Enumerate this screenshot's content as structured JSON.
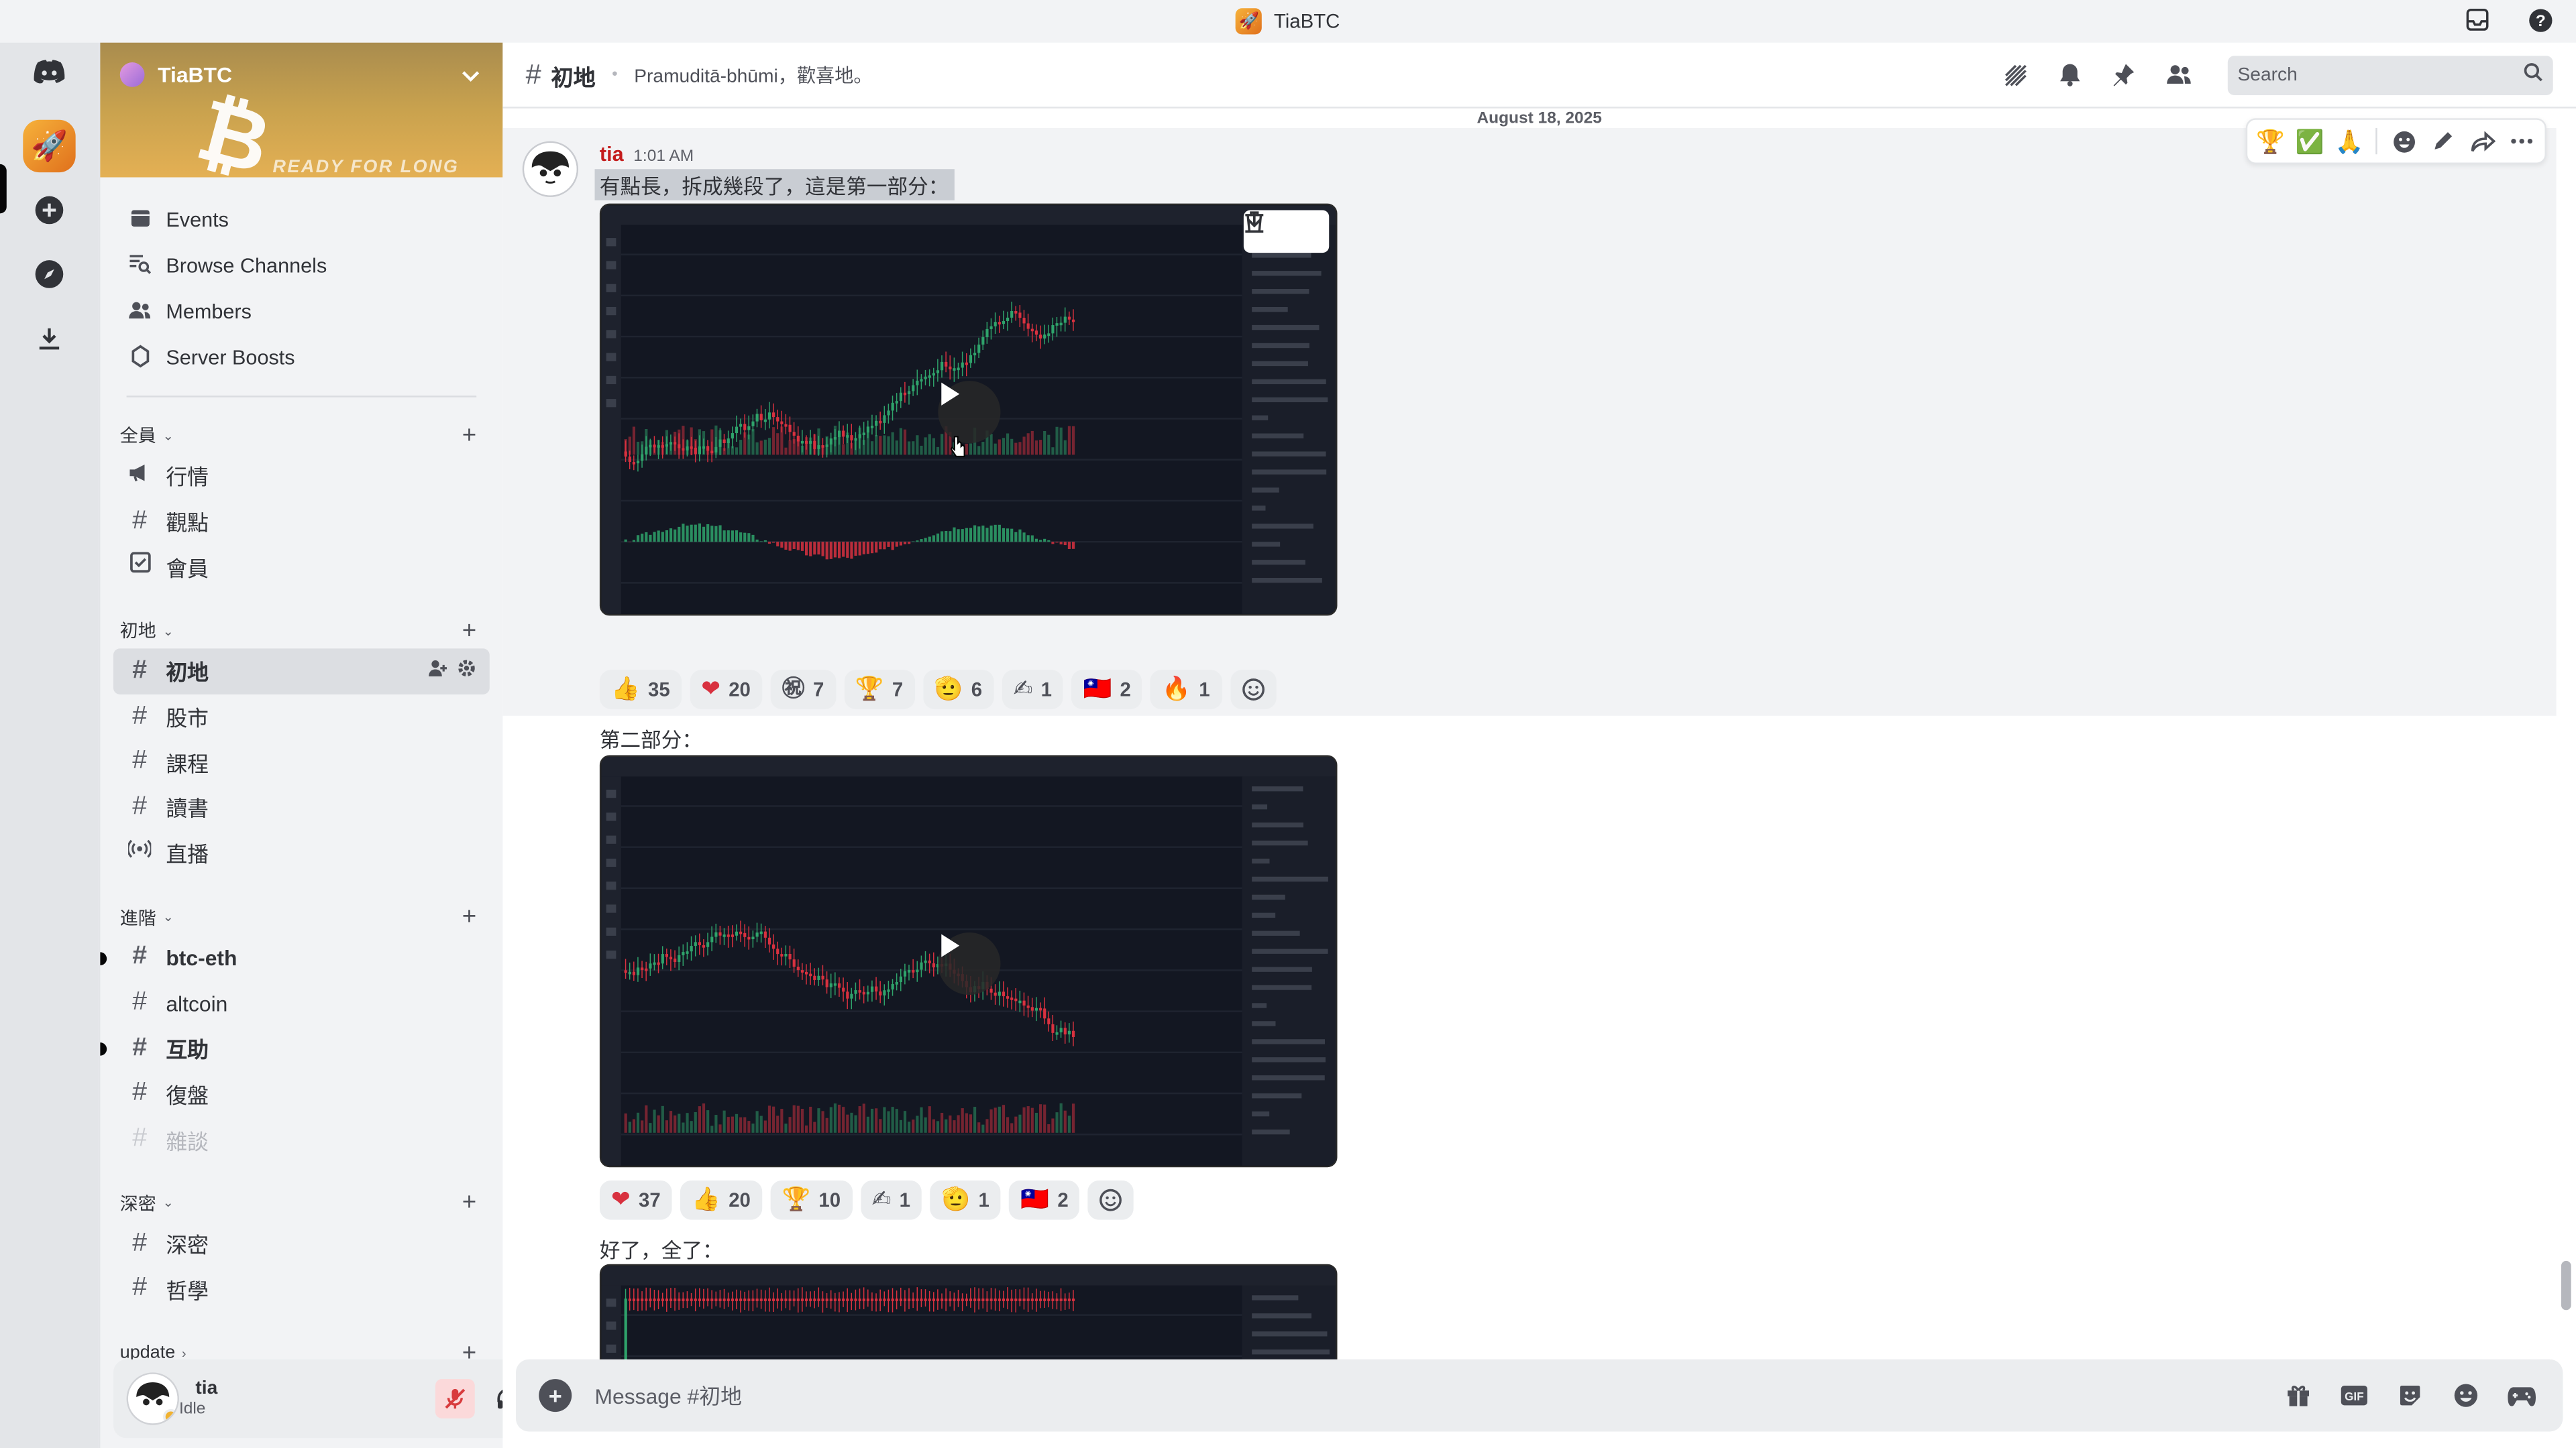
{
  "window": {
    "title": "TiaBTC"
  },
  "server": {
    "name": "TiaBTC",
    "banner_text": "READY FOR LONG"
  },
  "nav": [
    {
      "label": "Events",
      "icon": "calendar-icon"
    },
    {
      "label": "Browse Channels",
      "icon": "list-search-icon"
    },
    {
      "label": "Members",
      "icon": "members-icon"
    },
    {
      "label": "Server Boosts",
      "icon": "boost-icon"
    }
  ],
  "categories": [
    {
      "name": "全員",
      "channels": [
        {
          "name": "行情",
          "icon": "megaphone-icon"
        },
        {
          "name": "觀點",
          "icon": "hash-icon"
        },
        {
          "name": "會員",
          "icon": "checkbox-icon"
        }
      ]
    },
    {
      "name": "初地",
      "channels": [
        {
          "name": "初地",
          "icon": "hash-icon",
          "active": true
        },
        {
          "name": "股市",
          "icon": "hash-icon"
        },
        {
          "name": "課程",
          "icon": "hash-icon"
        },
        {
          "name": "讀書",
          "icon": "hash-icon"
        },
        {
          "name": "直播",
          "icon": "broadcast-icon"
        }
      ]
    },
    {
      "name": "進階",
      "channels": [
        {
          "name": "btc-eth",
          "icon": "hash-icon",
          "unread": true
        },
        {
          "name": "altcoin",
          "icon": "hash-icon"
        },
        {
          "name": "互助",
          "icon": "hash-icon",
          "unread": true
        },
        {
          "name": "復盤",
          "icon": "hash-icon"
        },
        {
          "name": "雜談",
          "icon": "hash-icon",
          "muted": true
        }
      ]
    },
    {
      "name": "深密",
      "channels": [
        {
          "name": "深密",
          "icon": "hash-icon"
        },
        {
          "name": "哲學",
          "icon": "hash-icon"
        }
      ]
    },
    {
      "name": "update",
      "channels": []
    }
  ],
  "user": {
    "name": "tia",
    "status": "Idle"
  },
  "channel": {
    "name": "初地",
    "topic": "Pramuditā-bhūmi，歡喜地。",
    "search_placeholder": "Search"
  },
  "date_divider": "August 18, 2025",
  "message": {
    "author": "tia",
    "time": "1:01 AM",
    "lines": [
      "有點長，拆成幾段了，這是第一部分：",
      "第二部分：",
      "好了，全了："
    ]
  },
  "reactions_1": [
    {
      "emoji": "👍",
      "count": "35"
    },
    {
      "emoji": "❤",
      "count": "20"
    },
    {
      "emoji": "㊗",
      "count": "7"
    },
    {
      "emoji": "🏆",
      "count": "7"
    },
    {
      "emoji": "🫡",
      "count": "6"
    },
    {
      "emoji": "✍",
      "count": "1"
    },
    {
      "emoji": "🇹🇼",
      "count": "2"
    },
    {
      "emoji": "🔥",
      "count": "1"
    }
  ],
  "reactions_2": [
    {
      "emoji": "❤",
      "count": "37"
    },
    {
      "emoji": "👍",
      "count": "20"
    },
    {
      "emoji": "🏆",
      "count": "10"
    },
    {
      "emoji": "✍",
      "count": "1"
    },
    {
      "emoji": "🫡",
      "count": "1"
    },
    {
      "emoji": "🇹🇼",
      "count": "2"
    }
  ],
  "hover_bar": {
    "quick_reactions": [
      "🏆",
      "✅",
      "🙏"
    ]
  },
  "composer": {
    "placeholder": "Message #初地"
  },
  "colors": {
    "author": "#c41c1c",
    "accent": "#5865f2",
    "chart_up": "#2fa36b",
    "chart_down": "#d8313f"
  }
}
